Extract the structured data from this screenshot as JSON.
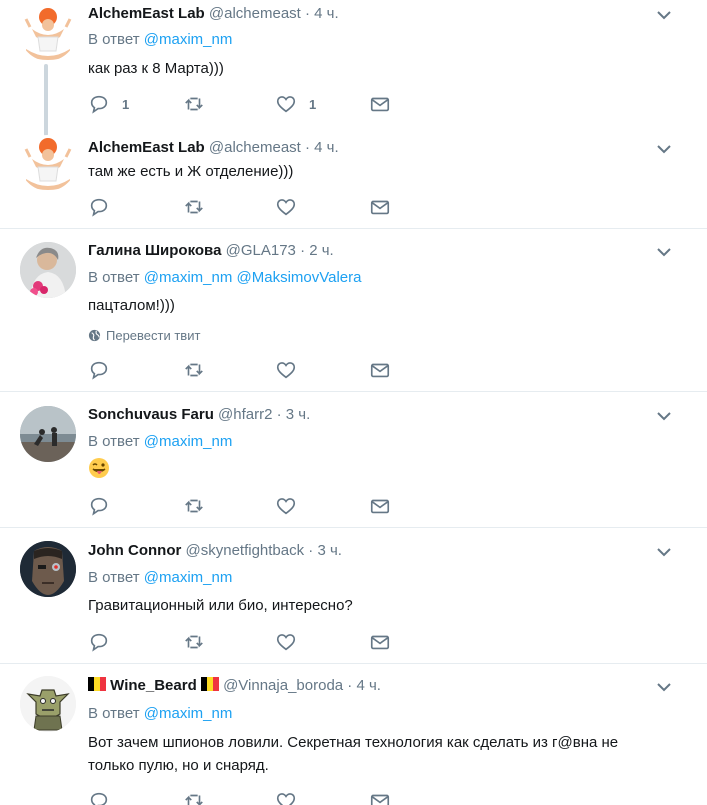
{
  "tweets": [
    {
      "name": "AlchemEast Lab",
      "handle": "@alchemeast",
      "dot": "·",
      "time": "4 ч.",
      "reply_prefix": "В ответ",
      "mentions": [
        "@maxim_nm"
      ],
      "text": "как раз к 8 Марта)))",
      "reply_count": "1",
      "retweet_count": "",
      "like_count": "1",
      "avatar_icon": "meditating-guru-avatar"
    },
    {
      "name": "AlchemEast Lab",
      "handle": "@alchemeast",
      "dot": "·",
      "time": "4 ч.",
      "text": "там же есть и Ж отделение)))",
      "avatar_icon": "meditating-guru-avatar"
    },
    {
      "name": "Галина Широкова",
      "handle": "@GLA173",
      "dot": "·",
      "time": "2 ч.",
      "reply_prefix": "В ответ",
      "mentions": [
        "@maxim_nm",
        "@MaksimovValera"
      ],
      "text": "пацталом!)))",
      "translate": "Перевести твит",
      "avatar_icon": "woman-with-flowers-avatar"
    },
    {
      "name": "Sonchuvaus Faru",
      "handle": "@hfarr2",
      "dot": "·",
      "time": "3 ч.",
      "reply_prefix": "В ответ",
      "mentions": [
        "@maxim_nm"
      ],
      "emoji": "winking-face-with-tongue",
      "avatar_icon": "beach-couple-avatar"
    },
    {
      "name": "John Connor",
      "handle": "@skynetfightback",
      "dot": "·",
      "time": "3 ч.",
      "reply_prefix": "В ответ",
      "mentions": [
        "@maxim_nm"
      ],
      "text": "Гравитационный или био, интересно?",
      "avatar_icon": "terminator-face-avatar"
    },
    {
      "name": "Wine_Beard",
      "handle": "@Vinnaja_boroda",
      "dot": "·",
      "time": "4 ч.",
      "reply_prefix": "В ответ",
      "mentions": [
        "@maxim_nm"
      ],
      "text": "Вот зачем шпионов ловили. Секретная технология как сделать из г@вна не только пулю, но и снаряд.",
      "avatar_icon": "goblin-avatar",
      "flag_colors": [
        "#000000",
        "#fdda24",
        "#ef3340"
      ]
    }
  ],
  "colors": {
    "link": "#1da1f2",
    "muted": "#657786",
    "separator": "#e6ecf0",
    "thread_line": "#ccd6dd"
  }
}
